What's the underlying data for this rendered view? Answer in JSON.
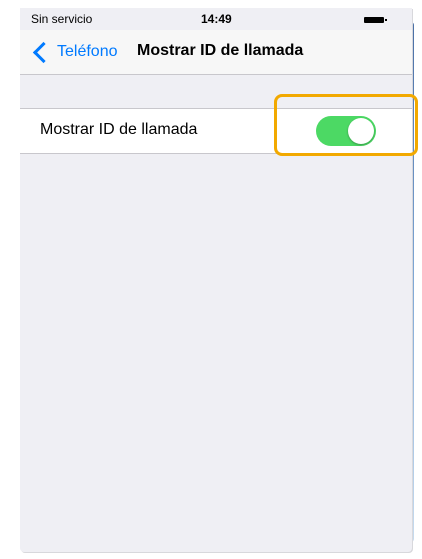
{
  "status_bar": {
    "carrier": "Sin servicio",
    "time": "14:49",
    "battery_icon": "battery-full-icon"
  },
  "nav": {
    "back_label": "Teléfono",
    "back_icon": "chevron-left-icon",
    "title": "Mostrar ID de llamada"
  },
  "settings": {
    "caller_id": {
      "label": "Mostrar ID de llamada",
      "toggle_on": true
    }
  },
  "colors": {
    "accent": "#007aff",
    "toggle_on": "#4cd964",
    "highlight": "#f2a900",
    "background": "#efeff4"
  }
}
